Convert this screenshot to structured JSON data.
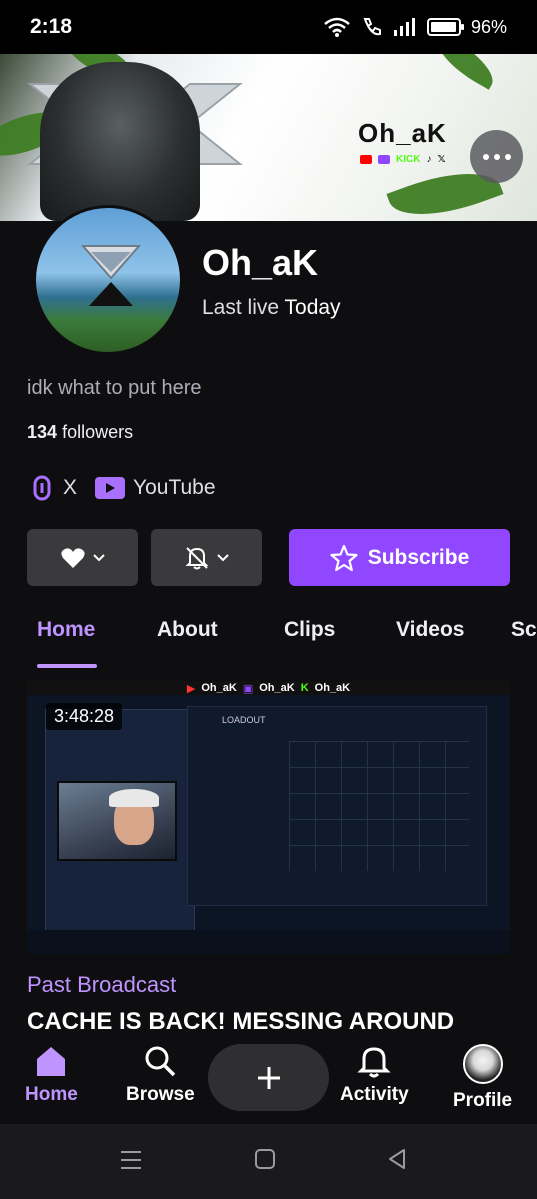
{
  "status_bar": {
    "time": "2:18",
    "battery": "96%",
    "battery_level": 0.96
  },
  "banner": {
    "logo_text": "Oh_aK",
    "social_text": "KICK"
  },
  "channel": {
    "name": "Oh_aK",
    "last_live_label": "Last live",
    "last_live_value": "Today",
    "bio": "idk what to put here",
    "followers_count": "134",
    "followers_label": "followers"
  },
  "links": [
    {
      "label": "X",
      "icon": "link-icon"
    },
    {
      "label": "YouTube",
      "icon": "youtube-icon"
    }
  ],
  "actions": {
    "subscribe_label": "Subscribe"
  },
  "tabs": [
    {
      "label": "Home",
      "active": true
    },
    {
      "label": "About"
    },
    {
      "label": "Clips"
    },
    {
      "label": "Videos"
    },
    {
      "label": "Sc"
    }
  ],
  "video": {
    "duration": "3:48:28",
    "type": "Past Broadcast",
    "title": "CACHE IS BACK! MESSING AROUND",
    "overlay_text": "Oh_aK",
    "panel_label": "LOADOUT"
  },
  "bottom_nav": [
    {
      "label": "Home",
      "icon": "home-icon",
      "active": true
    },
    {
      "label": "Browse",
      "icon": "search-icon"
    },
    {
      "label": "",
      "icon": "plus-icon"
    },
    {
      "label": "Activity",
      "icon": "bell-icon"
    },
    {
      "label": "Profile",
      "icon": "avatar-icon"
    }
  ],
  "colors": {
    "accent": "#9147ff",
    "accent_light": "#bf94ff",
    "background": "#0e0e10",
    "button_dark": "#3a3a3d"
  }
}
